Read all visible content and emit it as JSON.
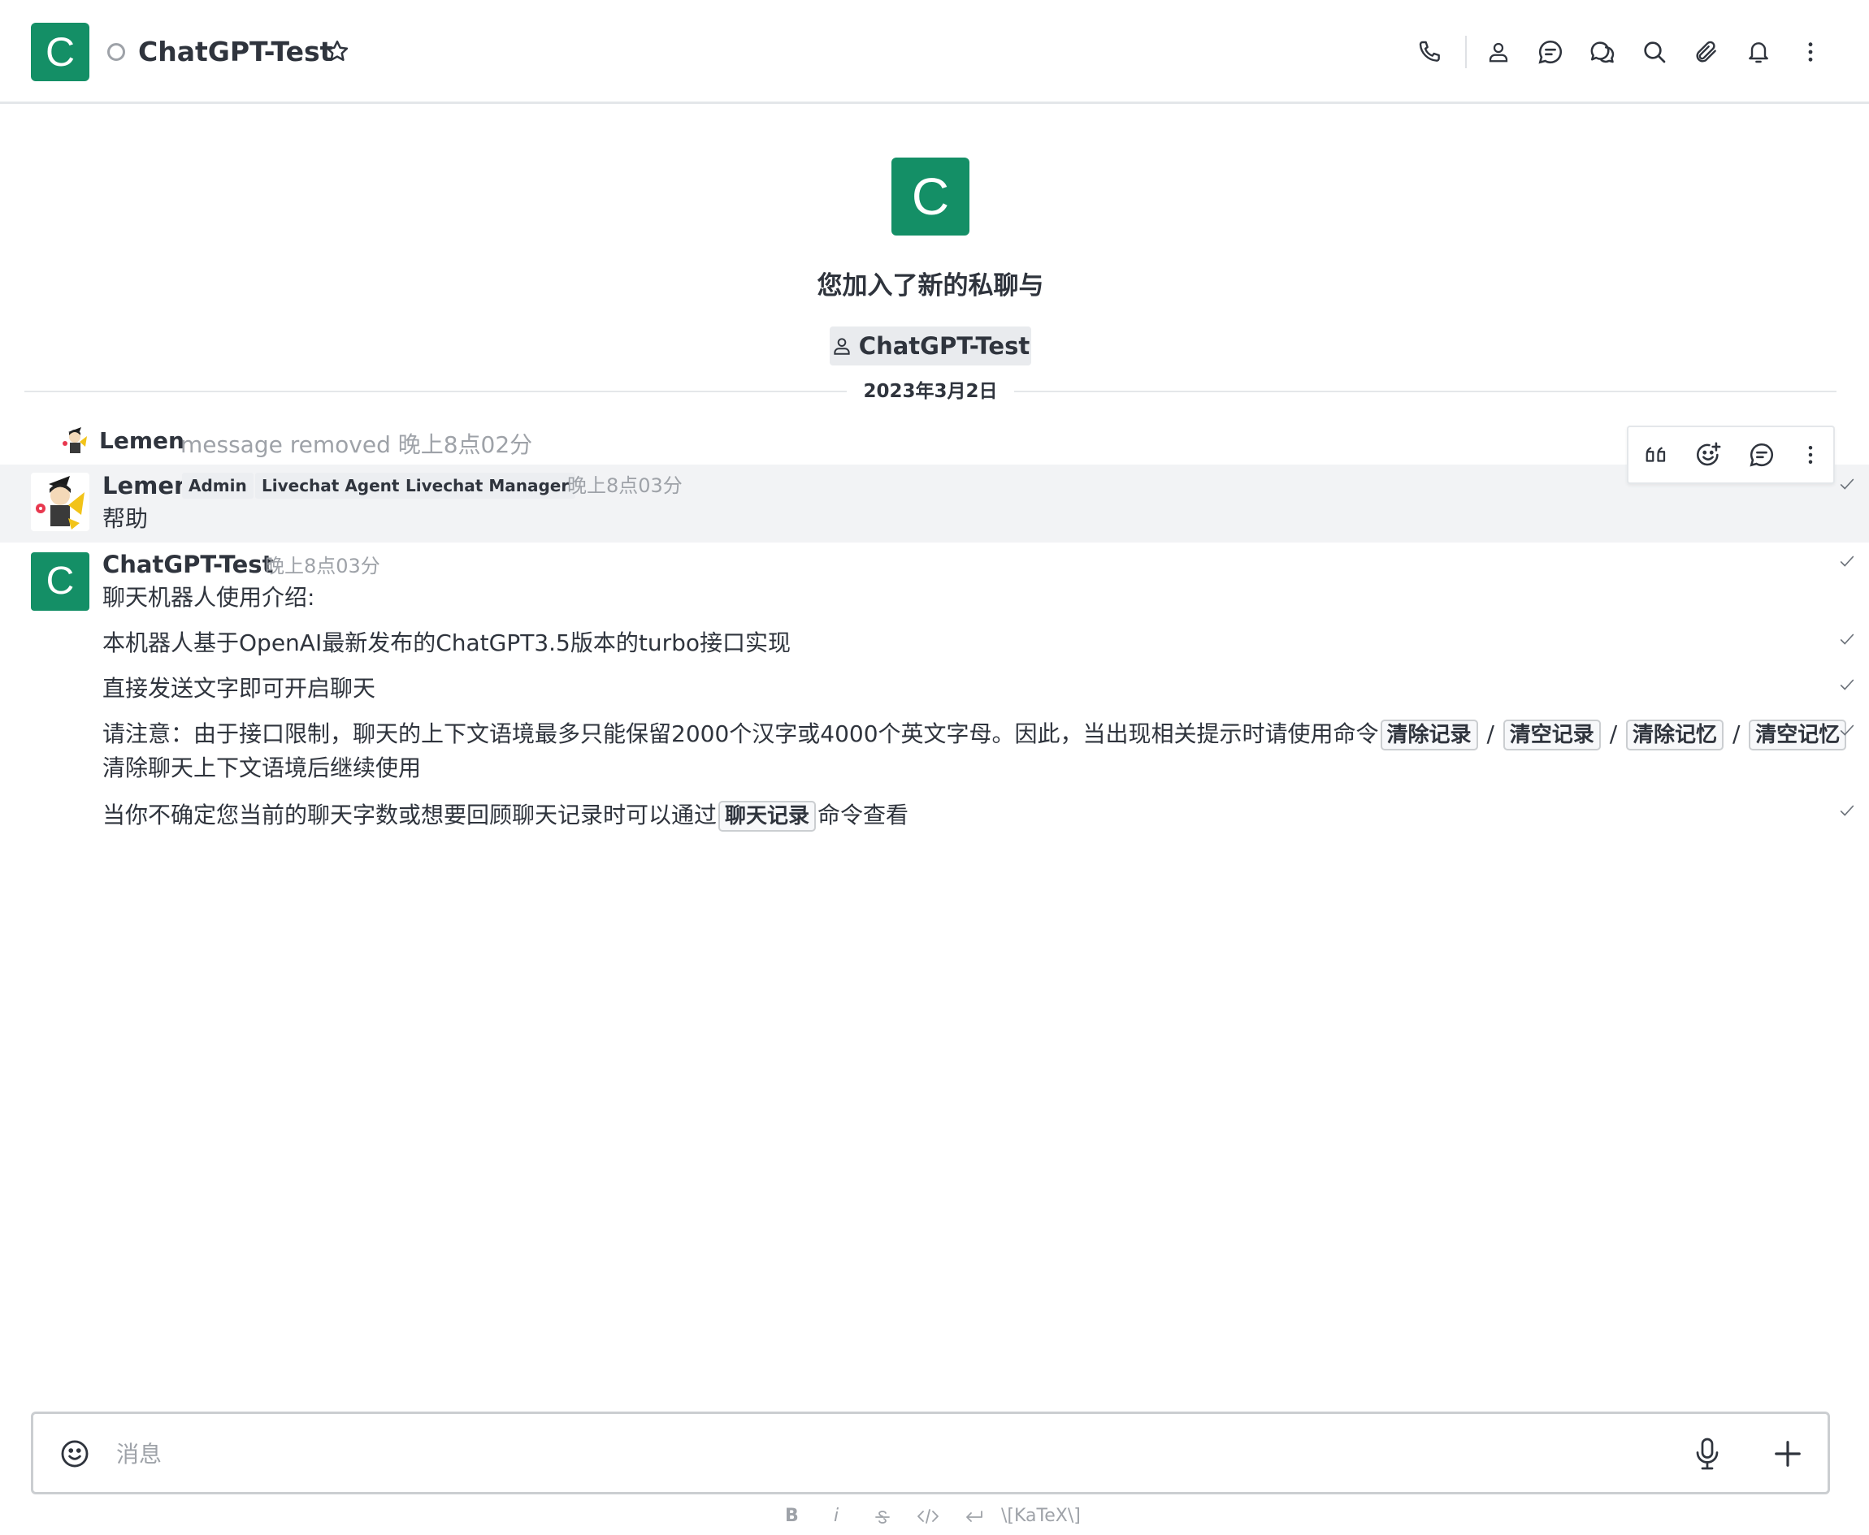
{
  "header": {
    "avatar_letter": "C",
    "room_name": "ChatGPT-Test",
    "icons": [
      "phone-icon",
      "user-info-icon",
      "discussion-icon",
      "threads-icon",
      "search-icon",
      "attachment-icon",
      "bell-icon",
      "kebab-icon"
    ]
  },
  "intro": {
    "avatar_letter": "C",
    "text": "您加入了新的私聊与",
    "chip_label": "ChatGPT-Test"
  },
  "date_divider": "2023年3月2日",
  "system_message": {
    "user": "Lemen",
    "text": "message removed 晚上8点02分"
  },
  "messages": [
    {
      "user": "Lemen",
      "roles": [
        "Admin",
        "Livechat Agent",
        "Livechat Manager"
      ],
      "time": "晚上8点03分",
      "body": "帮助"
    },
    {
      "user": "ChatGPT-Test",
      "avatar_letter": "C",
      "time": "晚上8点03分",
      "lines": {
        "l1": "聊天机器人使用介绍:",
        "l2": "本机器人基于OpenAI最新发布的ChatGPT3.5版本的turbo接口实现",
        "l3": "直接发送文字即可开启聊天",
        "l4_prefix": "请注意：由于接口限制，聊天的上下文语境最多只能保留2000个汉字或4000个英文字母。因此，当出现相关提示时请使用命令",
        "cmd1": "清除记录",
        "sep1": " / ",
        "cmd2": "清空记录",
        "sep2": " / ",
        "cmd3": "清除记忆",
        "sep3": " / ",
        "cmd4": "清空记忆",
        "l4_suffix": "清除聊天上下文语境后继续使用",
        "l5_prefix": "当你不确定您当前的聊天字数或想要回顾聊天记录时可以通过",
        "cmd5": "聊天记录",
        "l5_suffix": "命令查看"
      }
    }
  ],
  "message_actions": [
    "quote-icon",
    "add-reaction-icon",
    "reply-in-thread-icon",
    "kebab-icon"
  ],
  "composer": {
    "placeholder": "消息"
  },
  "format_bar": {
    "bold": "B",
    "italic": "i",
    "katex": "\\[KaTeX\\]"
  },
  "colors": {
    "brand_green": "#148f66",
    "text": "#2f343d",
    "muted": "#9ea2a8"
  }
}
